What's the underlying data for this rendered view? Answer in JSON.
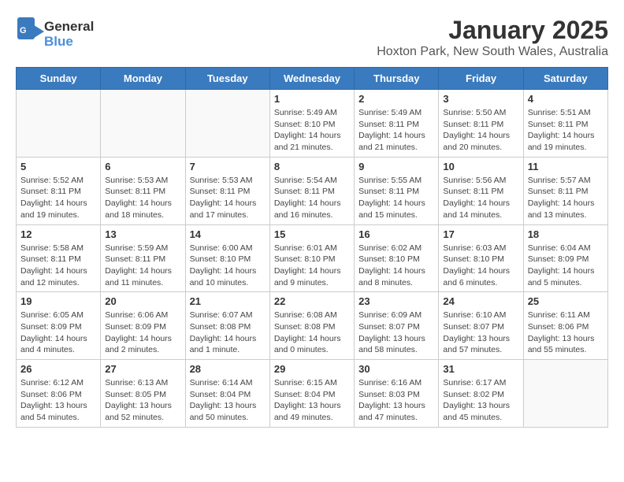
{
  "header": {
    "logo_general": "General",
    "logo_blue": "Blue",
    "title": "January 2025",
    "subtitle": "Hoxton Park, New South Wales, Australia"
  },
  "days_of_week": [
    "Sunday",
    "Monday",
    "Tuesday",
    "Wednesday",
    "Thursday",
    "Friday",
    "Saturday"
  ],
  "weeks": [
    [
      {
        "day": "",
        "info": ""
      },
      {
        "day": "",
        "info": ""
      },
      {
        "day": "",
        "info": ""
      },
      {
        "day": "1",
        "info": "Sunrise: 5:49 AM\nSunset: 8:10 PM\nDaylight: 14 hours\nand 21 minutes."
      },
      {
        "day": "2",
        "info": "Sunrise: 5:49 AM\nSunset: 8:11 PM\nDaylight: 14 hours\nand 21 minutes."
      },
      {
        "day": "3",
        "info": "Sunrise: 5:50 AM\nSunset: 8:11 PM\nDaylight: 14 hours\nand 20 minutes."
      },
      {
        "day": "4",
        "info": "Sunrise: 5:51 AM\nSunset: 8:11 PM\nDaylight: 14 hours\nand 19 minutes."
      }
    ],
    [
      {
        "day": "5",
        "info": "Sunrise: 5:52 AM\nSunset: 8:11 PM\nDaylight: 14 hours\nand 19 minutes."
      },
      {
        "day": "6",
        "info": "Sunrise: 5:53 AM\nSunset: 8:11 PM\nDaylight: 14 hours\nand 18 minutes."
      },
      {
        "day": "7",
        "info": "Sunrise: 5:53 AM\nSunset: 8:11 PM\nDaylight: 14 hours\nand 17 minutes."
      },
      {
        "day": "8",
        "info": "Sunrise: 5:54 AM\nSunset: 8:11 PM\nDaylight: 14 hours\nand 16 minutes."
      },
      {
        "day": "9",
        "info": "Sunrise: 5:55 AM\nSunset: 8:11 PM\nDaylight: 14 hours\nand 15 minutes."
      },
      {
        "day": "10",
        "info": "Sunrise: 5:56 AM\nSunset: 8:11 PM\nDaylight: 14 hours\nand 14 minutes."
      },
      {
        "day": "11",
        "info": "Sunrise: 5:57 AM\nSunset: 8:11 PM\nDaylight: 14 hours\nand 13 minutes."
      }
    ],
    [
      {
        "day": "12",
        "info": "Sunrise: 5:58 AM\nSunset: 8:11 PM\nDaylight: 14 hours\nand 12 minutes."
      },
      {
        "day": "13",
        "info": "Sunrise: 5:59 AM\nSunset: 8:11 PM\nDaylight: 14 hours\nand 11 minutes."
      },
      {
        "day": "14",
        "info": "Sunrise: 6:00 AM\nSunset: 8:10 PM\nDaylight: 14 hours\nand 10 minutes."
      },
      {
        "day": "15",
        "info": "Sunrise: 6:01 AM\nSunset: 8:10 PM\nDaylight: 14 hours\nand 9 minutes."
      },
      {
        "day": "16",
        "info": "Sunrise: 6:02 AM\nSunset: 8:10 PM\nDaylight: 14 hours\nand 8 minutes."
      },
      {
        "day": "17",
        "info": "Sunrise: 6:03 AM\nSunset: 8:10 PM\nDaylight: 14 hours\nand 6 minutes."
      },
      {
        "day": "18",
        "info": "Sunrise: 6:04 AM\nSunset: 8:09 PM\nDaylight: 14 hours\nand 5 minutes."
      }
    ],
    [
      {
        "day": "19",
        "info": "Sunrise: 6:05 AM\nSunset: 8:09 PM\nDaylight: 14 hours\nand 4 minutes."
      },
      {
        "day": "20",
        "info": "Sunrise: 6:06 AM\nSunset: 8:09 PM\nDaylight: 14 hours\nand 2 minutes."
      },
      {
        "day": "21",
        "info": "Sunrise: 6:07 AM\nSunset: 8:08 PM\nDaylight: 14 hours\nand 1 minute."
      },
      {
        "day": "22",
        "info": "Sunrise: 6:08 AM\nSunset: 8:08 PM\nDaylight: 14 hours\nand 0 minutes."
      },
      {
        "day": "23",
        "info": "Sunrise: 6:09 AM\nSunset: 8:07 PM\nDaylight: 13 hours\nand 58 minutes."
      },
      {
        "day": "24",
        "info": "Sunrise: 6:10 AM\nSunset: 8:07 PM\nDaylight: 13 hours\nand 57 minutes."
      },
      {
        "day": "25",
        "info": "Sunrise: 6:11 AM\nSunset: 8:06 PM\nDaylight: 13 hours\nand 55 minutes."
      }
    ],
    [
      {
        "day": "26",
        "info": "Sunrise: 6:12 AM\nSunset: 8:06 PM\nDaylight: 13 hours\nand 54 minutes."
      },
      {
        "day": "27",
        "info": "Sunrise: 6:13 AM\nSunset: 8:05 PM\nDaylight: 13 hours\nand 52 minutes."
      },
      {
        "day": "28",
        "info": "Sunrise: 6:14 AM\nSunset: 8:04 PM\nDaylight: 13 hours\nand 50 minutes."
      },
      {
        "day": "29",
        "info": "Sunrise: 6:15 AM\nSunset: 8:04 PM\nDaylight: 13 hours\nand 49 minutes."
      },
      {
        "day": "30",
        "info": "Sunrise: 6:16 AM\nSunset: 8:03 PM\nDaylight: 13 hours\nand 47 minutes."
      },
      {
        "day": "31",
        "info": "Sunrise: 6:17 AM\nSunset: 8:02 PM\nDaylight: 13 hours\nand 45 minutes."
      },
      {
        "day": "",
        "info": ""
      }
    ]
  ]
}
